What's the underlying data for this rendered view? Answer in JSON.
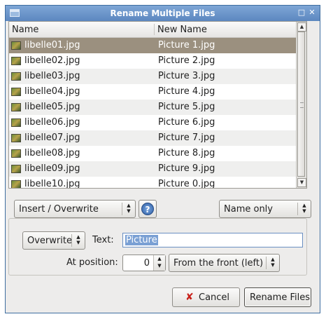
{
  "window": {
    "title": "Rename Multiple Files"
  },
  "list": {
    "columns": {
      "name": "Name",
      "new_name": "New Name"
    },
    "rows": [
      {
        "name": "libelle01.jpg",
        "new_name": "Picture 1.jpg"
      },
      {
        "name": "libelle02.jpg",
        "new_name": "Picture 2.jpg"
      },
      {
        "name": "libelle03.jpg",
        "new_name": "Picture 3.jpg"
      },
      {
        "name": "libelle04.jpg",
        "new_name": "Picture 4.jpg"
      },
      {
        "name": "libelle05.jpg",
        "new_name": "Picture 5.jpg"
      },
      {
        "name": "libelle06.jpg",
        "new_name": "Picture 6.jpg"
      },
      {
        "name": "libelle07.jpg",
        "new_name": "Picture 7.jpg"
      },
      {
        "name": "libelle08.jpg",
        "new_name": "Picture 8.jpg"
      },
      {
        "name": "libelle09.jpg",
        "new_name": "Picture 9.jpg"
      },
      {
        "name": "libelle10.jpg",
        "new_name": "Picture 0.jpg"
      }
    ]
  },
  "controls": {
    "mode_select": "Insert / Overwrite",
    "scope_select": "Name only",
    "operation_select": "Overwrite",
    "text_label": "Text:",
    "text_value": "Picture",
    "position_label": "At position:",
    "position_value": "0",
    "direction_select": "From the front (left)"
  },
  "buttons": {
    "cancel": "Cancel",
    "rename": "Rename Files"
  }
}
